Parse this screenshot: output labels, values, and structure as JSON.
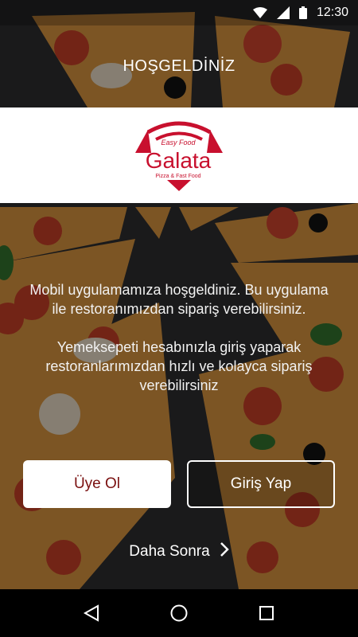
{
  "status_bar": {
    "time": "12:30"
  },
  "welcome": {
    "title": "HOŞGELDİNİZ"
  },
  "logo": {
    "tagline": "Easy Food",
    "name": "Galata",
    "subtitle": "Pizza & Fast Food",
    "brand_color": "#c8102e"
  },
  "intro": {
    "paragraph1": "Mobil uygulamamıza hoşgeldiniz. Bu uygulama ile restoranımızdan sipariş verebilirsiniz.",
    "paragraph2": "Yemeksepeti hesabınızla giriş yaparak restoranlarımızdan hızlı ve kolayca sipariş verebilirsiniz"
  },
  "actions": {
    "register_label": "Üye Ol",
    "login_label": "Giriş Yap",
    "later_label": "Daha Sonra"
  },
  "nav": {
    "back": "back-icon",
    "home": "home-icon",
    "recents": "recents-icon"
  }
}
